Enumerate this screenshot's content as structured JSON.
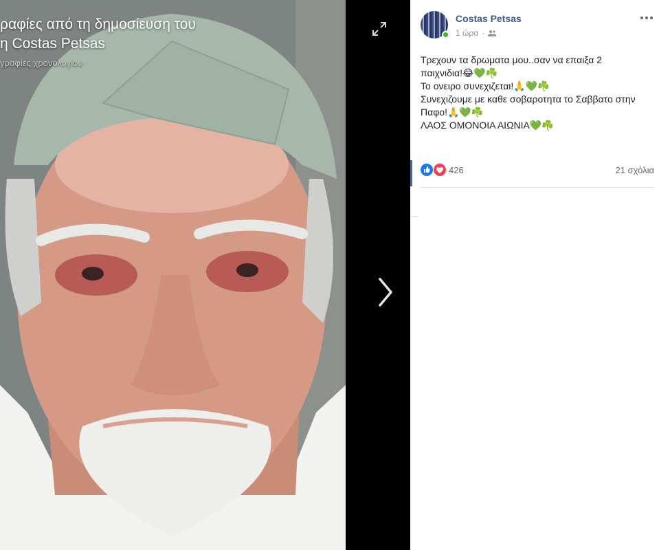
{
  "viewer": {
    "title_line1": "ραφίες από τη δημοσίευση του",
    "title_line2": "η Costas Petsas",
    "subtitle": "γραφίες χρονολογίου",
    "expand_icon": "expand-icon",
    "next_icon": "chevron-right-icon"
  },
  "post": {
    "author": "Costas Petsas",
    "time": "1 ώρα",
    "audience_icon": "friends-icon",
    "text_lines": [
      "Τρεχουν τα δρωματα μου..σαν να επαιξα 2",
      "παιχνιδια!😂💚☘️",
      "Το ονειρο συνεχιζεται!🙏💚☘️",
      "Συνεχιζουμε με καθε σοβαροτητα το Σαββατο στην",
      "Παφο!🙏💚☘️",
      "ΛΑΟΣ ΟΜΟΝΟΙΑ ΑΙΩΝΙΑ💚☘️"
    ],
    "reactions_count": "426",
    "comments": "21 σχόλια",
    "reaction_icons": [
      "like-icon",
      "love-icon"
    ]
  },
  "colors": {
    "link": "#385898",
    "online": "#42b72a",
    "like": "#1877f2",
    "love": "#f33e58"
  }
}
